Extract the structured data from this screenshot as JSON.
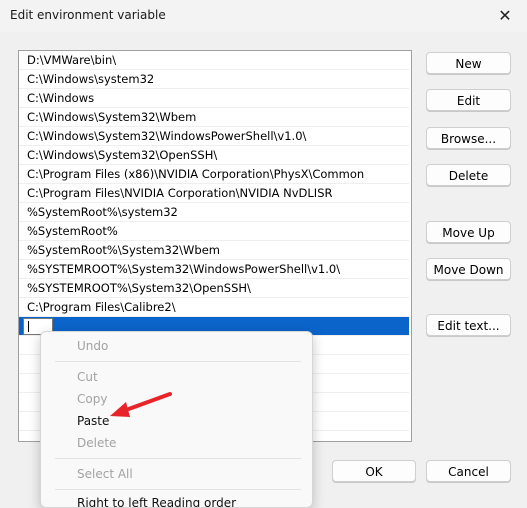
{
  "window": {
    "title": "Edit environment variable",
    "close_glyph": "✕"
  },
  "list": {
    "entries": [
      "D:\\VMWare\\bin\\",
      "C:\\Windows\\system32",
      "C:\\Windows",
      "C:\\Windows\\System32\\Wbem",
      "C:\\Windows\\System32\\WindowsPowerShell\\v1.0\\",
      "C:\\Windows\\System32\\OpenSSH\\",
      "C:\\Program Files (x86)\\NVIDIA Corporation\\PhysX\\Common",
      "C:\\Program Files\\NVIDIA Corporation\\NVIDIA NvDLISR",
      "%SystemRoot%\\system32",
      "%SystemRoot%",
      "%SystemRoot%\\System32\\Wbem",
      "%SYSTEMROOT%\\System32\\WindowsPowerShell\\v1.0\\",
      "%SYSTEMROOT%\\System32\\OpenSSH\\",
      "C:\\Program Files\\Calibre2\\"
    ],
    "editing_value": ""
  },
  "buttons": {
    "new": "New",
    "edit": "Edit",
    "browse": "Browse...",
    "delete": "Delete",
    "move_up": "Move Up",
    "move_down": "Move Down",
    "edit_text": "Edit text...",
    "ok": "OK",
    "cancel": "Cancel"
  },
  "context_menu": {
    "undo": "Undo",
    "cut": "Cut",
    "copy": "Copy",
    "paste": "Paste",
    "delete": "Delete",
    "select_all": "Select All",
    "rtl": "Right to left Reading order"
  },
  "annotation": {
    "icon": "red-arrow-icon",
    "color": "#e8242b"
  },
  "colors": {
    "selection": "#0b64c9",
    "disabled_text": "#a2a2a2"
  }
}
